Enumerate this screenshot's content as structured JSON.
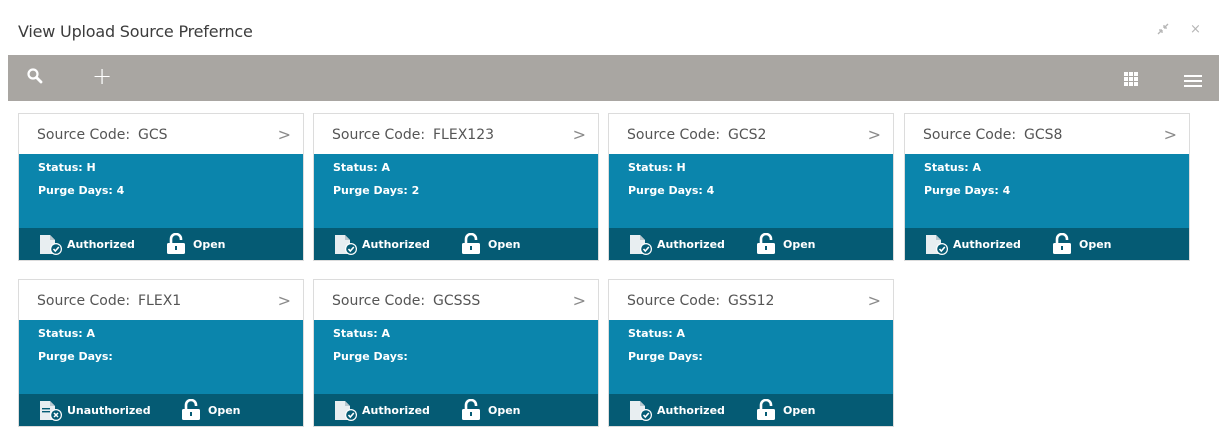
{
  "window": {
    "title": "View Upload Source Prefernce",
    "minimize_icon": "collapse-arrows-icon",
    "close_label": "×"
  },
  "toolbar": {
    "search_icon": "search-icon",
    "add_label": "+",
    "grid_icon": "grid-view-icon",
    "list_icon": "list-view-icon"
  },
  "colors": {
    "toolbar_bg": "#a9a6a2",
    "card_body_bg": "#0b85ac",
    "card_footer_bg": "#055b74"
  },
  "cards": [
    {
      "code_label": "Source Code:",
      "code_value": "GCS",
      "status_label": "Status:",
      "status_value": "H",
      "purge_label": "Purge Days:",
      "purge_value": "4",
      "auth_status": "Authorized",
      "record_status": "Open",
      "auth_icon": "authorized-doc-icon",
      "lock_icon": "unlocked-padlock-icon",
      "chevron": ">"
    },
    {
      "code_label": "Source Code:",
      "code_value": "FLEX123",
      "status_label": "Status:",
      "status_value": "A",
      "purge_label": "Purge Days:",
      "purge_value": "2",
      "auth_status": "Authorized",
      "record_status": "Open",
      "auth_icon": "authorized-doc-icon",
      "lock_icon": "unlocked-padlock-icon",
      "chevron": ">"
    },
    {
      "code_label": "Source Code:",
      "code_value": "GCS2",
      "status_label": "Status:",
      "status_value": "H",
      "purge_label": "Purge Days:",
      "purge_value": "4",
      "auth_status": "Authorized",
      "record_status": "Open",
      "auth_icon": "authorized-doc-icon",
      "lock_icon": "unlocked-padlock-icon",
      "chevron": ">"
    },
    {
      "code_label": "Source Code:",
      "code_value": "GCS8",
      "status_label": "Status:",
      "status_value": "A",
      "purge_label": "Purge Days:",
      "purge_value": "4",
      "auth_status": "Authorized",
      "record_status": "Open",
      "auth_icon": "authorized-doc-icon",
      "lock_icon": "unlocked-padlock-icon",
      "chevron": ">"
    },
    {
      "code_label": "Source Code:",
      "code_value": "FLEX1",
      "status_label": "Status:",
      "status_value": "A",
      "purge_label": "Purge Days:",
      "purge_value": "",
      "auth_status": "Unauthorized",
      "record_status": "Open",
      "auth_icon": "unauthorized-doc-icon",
      "lock_icon": "unlocked-padlock-icon",
      "chevron": ">"
    },
    {
      "code_label": "Source Code:",
      "code_value": "GCSSS",
      "status_label": "Status:",
      "status_value": "A",
      "purge_label": "Purge Days:",
      "purge_value": "",
      "auth_status": "Authorized",
      "record_status": "Open",
      "auth_icon": "authorized-doc-icon",
      "lock_icon": "unlocked-padlock-icon",
      "chevron": ">"
    },
    {
      "code_label": "Source Code:",
      "code_value": "GSS12",
      "status_label": "Status:",
      "status_value": "A",
      "purge_label": "Purge Days:",
      "purge_value": "",
      "auth_status": "Authorized",
      "record_status": "Open",
      "auth_icon": "authorized-doc-icon",
      "lock_icon": "unlocked-padlock-icon",
      "chevron": ">"
    }
  ]
}
